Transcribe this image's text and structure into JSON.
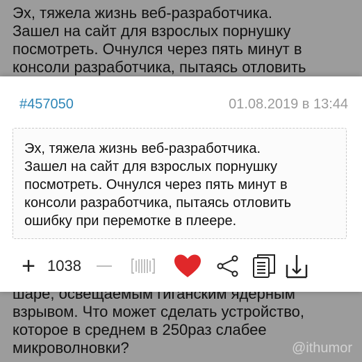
{
  "background": {
    "top_lines": [
      "Эх, тяжела жизнь веб-разработчика.",
      "Зашел на сайт для взрослых порнушку",
      "посмотреть. Очнулся через пять минут в",
      "консоли разработчика, пытаясь отловить"
    ],
    "bottom_lines": [
      "шаре, освещаемым гиганским ядерным",
      "взрывом. Что может сделать устройство,",
      "которое в среднем в 250раз слабее",
      "микроволновки?"
    ],
    "watermark": "@ithumor"
  },
  "card": {
    "post_id": "#457050",
    "date": "01.08.2019 в 13:44",
    "quote_lines": [
      "Эх, тяжела жизнь веб-разработчика.",
      "Зашел на сайт для взрослых порнушку",
      "посмотреть. Очнулся через пять минут в",
      "консоли разработчика, пытаясь отловить",
      "ошибку при перемотке в плеере."
    ],
    "toolbar": {
      "plus": "+",
      "score": "1038",
      "icons": [
        "plus-icon",
        "minus-icon",
        "bayan-icon",
        "heart-icon",
        "share-icon",
        "copy-icon",
        "save-icon"
      ]
    }
  },
  "colors": {
    "post_id": "#2f87b8",
    "heart": "#e0282a",
    "date": "#9a9a9a"
  }
}
